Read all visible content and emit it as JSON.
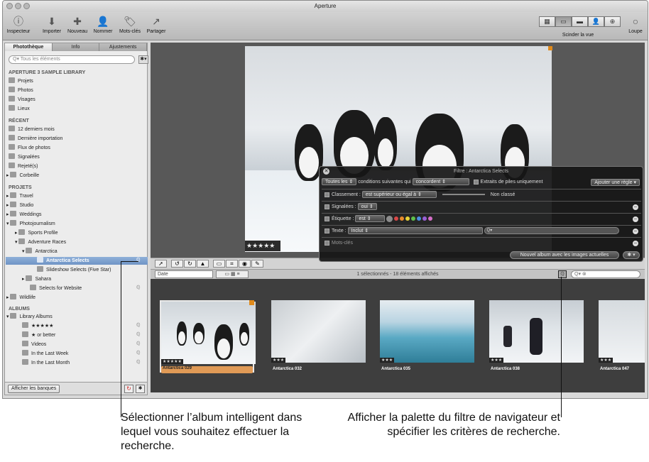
{
  "window": {
    "title": "Aperture"
  },
  "toolbar": {
    "buttons": [
      "Inspecteur",
      "Importer",
      "Nouveau",
      "Nommer",
      "Mots-clés",
      "Partager"
    ],
    "split_label": "Scinder la vue",
    "loupe_label": "Loupe"
  },
  "sidebar": {
    "tabs": [
      "Photothèque",
      "Info",
      "Ajustements"
    ],
    "search_placeholder": "Tous les éléments",
    "library_header": "APERTURE 3 SAMPLE LIBRARY",
    "library_items": [
      "Projets",
      "Photos",
      "Visages",
      "Lieux"
    ],
    "recent_header": "RÉCENT",
    "recent_items": [
      "12 derniers mois",
      "Dernière importation",
      "Flux de photos",
      "Signalées",
      "Rejeté(s)",
      "Corbeille"
    ],
    "projects_header": "PROJETS",
    "projects_items": [
      "Travel",
      "Studio",
      "Weddings",
      "Photojournalism",
      "Sports Profile",
      "Adventure Races",
      "Antarctica",
      "Antarctica Selects",
      "Slideshow Selects (Five Star)",
      "Sahara",
      "Selects for Website",
      "Wildlife"
    ],
    "albums_header": "ALBUMS",
    "albums_items": [
      "Library Albums",
      "★★★★★",
      "★ or better",
      "Videos",
      "In the Last Week",
      "In the Last Month"
    ],
    "show_vaults": "Afficher les banques"
  },
  "viewer": {
    "rating": "★★★★★"
  },
  "infobar": {
    "sort": "Date",
    "status": "1 sélectionnés - 18 éléments affichés"
  },
  "browser": {
    "thumbs": [
      {
        "name": "Antarctica 029",
        "rating": "★★★★★"
      },
      {
        "name": "Antarctica 032",
        "rating": "★★★"
      },
      {
        "name": "Antarctica 035",
        "rating": "★★★"
      },
      {
        "name": "Antarctica 038",
        "rating": "★★★"
      },
      {
        "name": "Antarctica 047",
        "rating": "★★★"
      }
    ]
  },
  "filter": {
    "title": "Filtre : Antarctica Selects",
    "match": "Toutes les",
    "match_text": "conditions suivantes qui",
    "match_op": "concordent",
    "stack_picks": "Extraits de piles uniquement",
    "add_rule": "Ajouter une règle",
    "rating_label": "Classement :",
    "rating_op": "est supérieur ou égal à",
    "rating_val": "Non classé",
    "flagged_label": "Signalées :",
    "flagged_val": "oui",
    "label_label": "Étiquette :",
    "label_op": "est",
    "text_label": "Texte :",
    "text_op": "Inclut",
    "keywords_label": "Mots-clés",
    "new_album": "Nouvel album avec les images actuelles",
    "label_colors": [
      "#8c8c8c",
      "#d94848",
      "#e88a2a",
      "#e6d23a",
      "#5fbf4a",
      "#4a8fe0",
      "#9a5fd6",
      "#d66fc8"
    ]
  },
  "annotations": {
    "left": "Sélectionner l’album intelligent dans lequel vous souhaitez effectuer la recherche.",
    "right": "Afficher la palette du filtre de navigateur et spécifier les critères de recherche."
  }
}
